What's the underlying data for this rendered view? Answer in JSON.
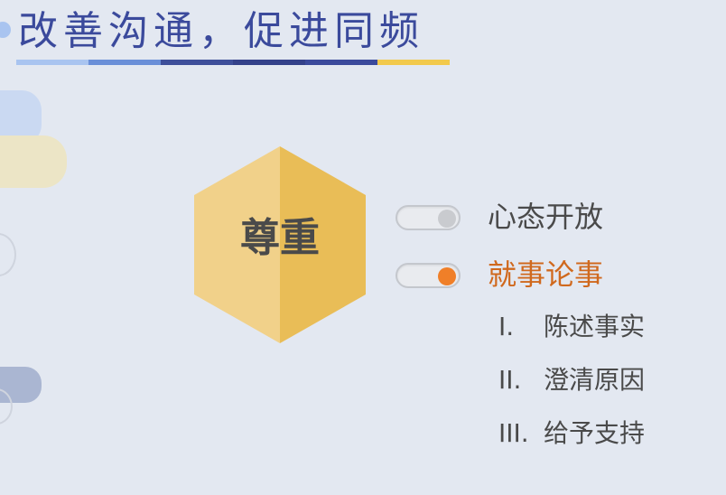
{
  "title": "改善沟通，促进同频",
  "underline_colors": [
    "#a9c4f0",
    "#6a8fd8",
    "#3e4f9a",
    "#34418a",
    "#3b4a9c",
    "#f2c94c"
  ],
  "center": {
    "label": "尊重",
    "color_left": "#f1d18a",
    "color_right": "#e9bd57"
  },
  "items": [
    {
      "label": "心态开放",
      "color": "#4a4a4a",
      "knob_color": "#c9cbcf"
    },
    {
      "label": "就事论事",
      "color": "#d0691e",
      "knob_color": "#f07f28"
    }
  ],
  "sub_items": [
    {
      "num": "I.",
      "label": "陈述事实"
    },
    {
      "num": "II.",
      "label": "澄清原因"
    },
    {
      "num": "III.",
      "label": "给予支持"
    }
  ]
}
